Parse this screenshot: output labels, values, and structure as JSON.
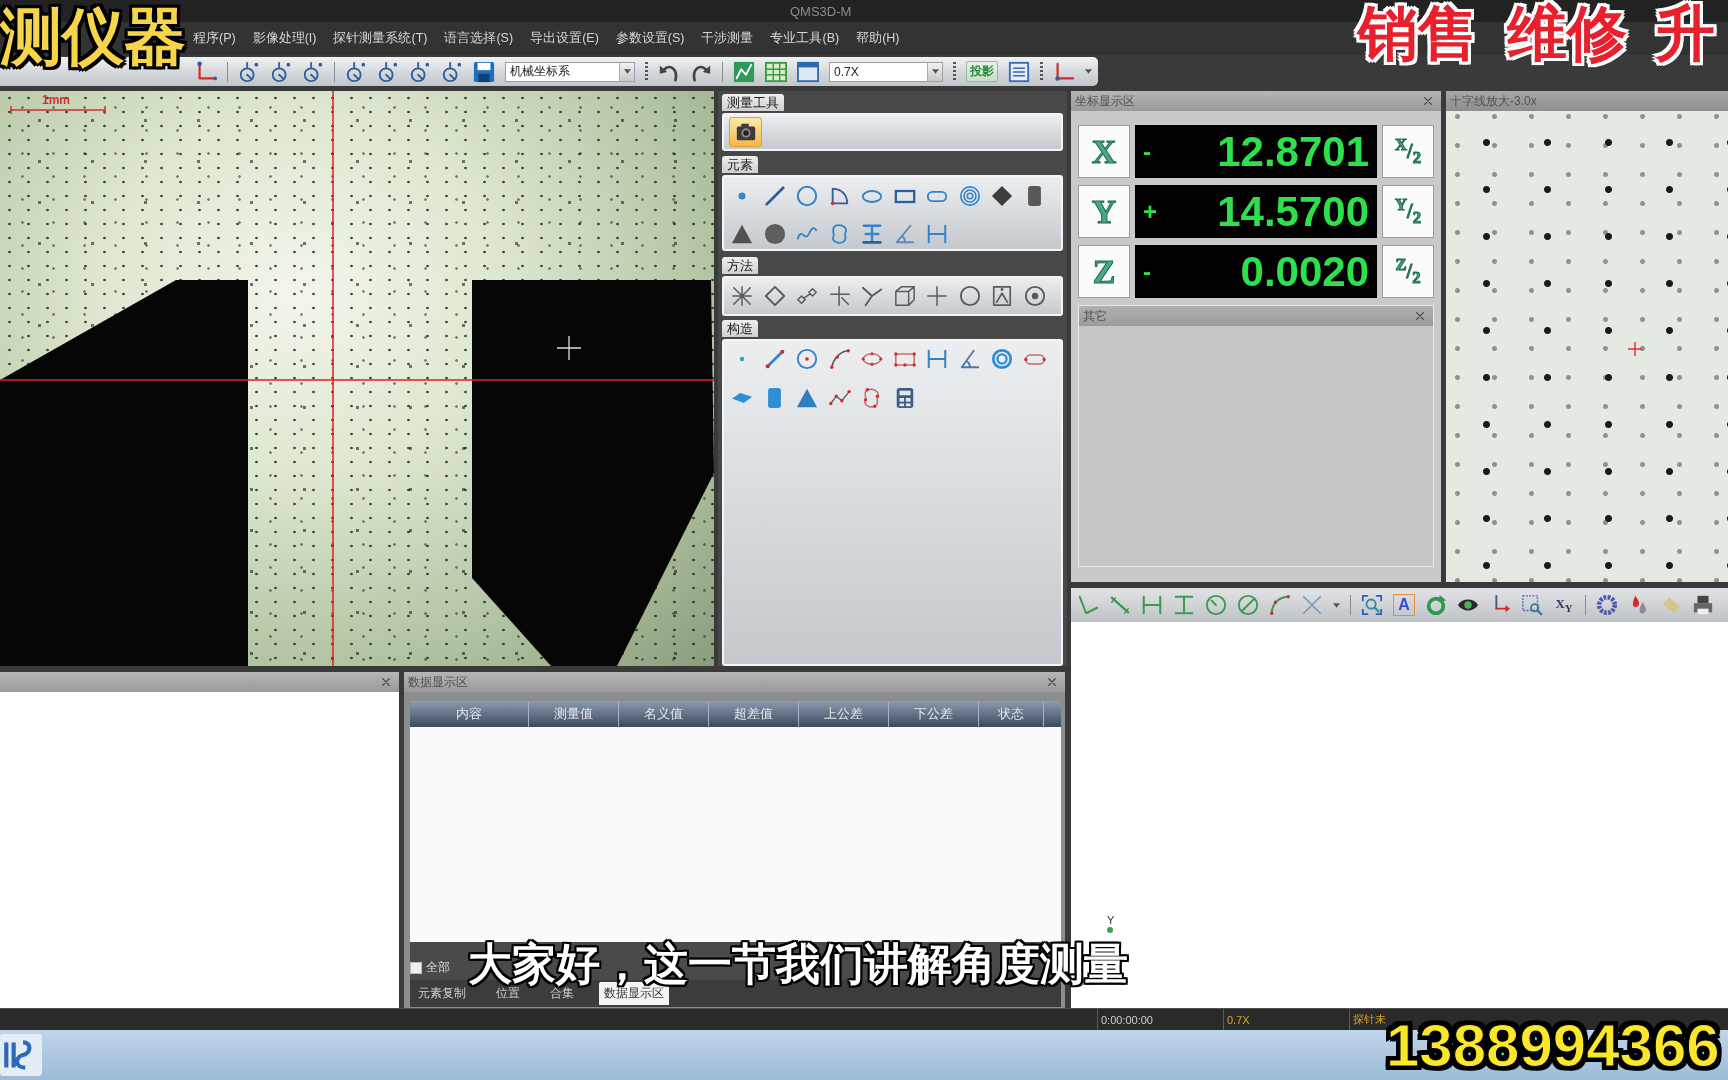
{
  "overlays": {
    "brand": "测仪器",
    "services": "销售 维修 升",
    "subtitle": "大家好，这一节我们讲解角度测量",
    "phone": "1388994366"
  },
  "window": {
    "title": "QMS3D-M"
  },
  "menu": [
    "程序(P)",
    "影像处理(I)",
    "探针测量系统(T)",
    "语言选择(S)",
    "导出设置(E)",
    "参数设置(S)",
    "干涉测量",
    "专业工具(B)",
    "帮助(H)"
  ],
  "toolbar": {
    "coordinate_system": "机械坐标系",
    "zoom": "0.7X",
    "projection": "投影"
  },
  "camera": {
    "scale_label": "1mm"
  },
  "tool_panel": {
    "measure_tool": {
      "selected": true
    },
    "sections": [
      {
        "title": "测量工具"
      },
      {
        "title": "元素"
      },
      {
        "title": "方法"
      },
      {
        "title": "构造"
      }
    ]
  },
  "coordinates": {
    "title": "坐标显示区",
    "axes": [
      {
        "axis": "X",
        "sign": "-",
        "value": "12.8701",
        "half": "$^{X}$/$_{2}$"
      },
      {
        "axis": "Y",
        "sign": "+",
        "value": "14.5700",
        "half": "$^{Y}$/$_{2}$"
      },
      {
        "axis": "Z",
        "sign": "-",
        "value": "0.0020",
        "half": "$^{Z}$/$_{2}$"
      }
    ]
  },
  "other_panel": {
    "title": "其它"
  },
  "magnifier": {
    "title": "十字线放大-3.0x"
  },
  "data_panel": {
    "title": "数据显示区",
    "columns": [
      "内容",
      "测量值",
      "名义值",
      "超差值",
      "上公差",
      "下公差",
      "状态"
    ],
    "show_all": {
      "label": "全部",
      "checked": false
    },
    "tabs": [
      {
        "label": "元素复制",
        "selected": false
      },
      {
        "label": "位置",
        "selected": false
      },
      {
        "label": "合集",
        "selected": false
      },
      {
        "label": "数据显示区",
        "selected": true
      }
    ]
  },
  "graphics": {
    "text_tool": "A",
    "axis_tool": "X$_{Y}$",
    "axis_label": "Y"
  },
  "status_bar": [
    {
      "text": "0:00:00:00",
      "kind": "plain"
    },
    {
      "text": "0.7X",
      "kind": "accent"
    },
    {
      "text": "探针未",
      "kind": "accent"
    }
  ]
}
